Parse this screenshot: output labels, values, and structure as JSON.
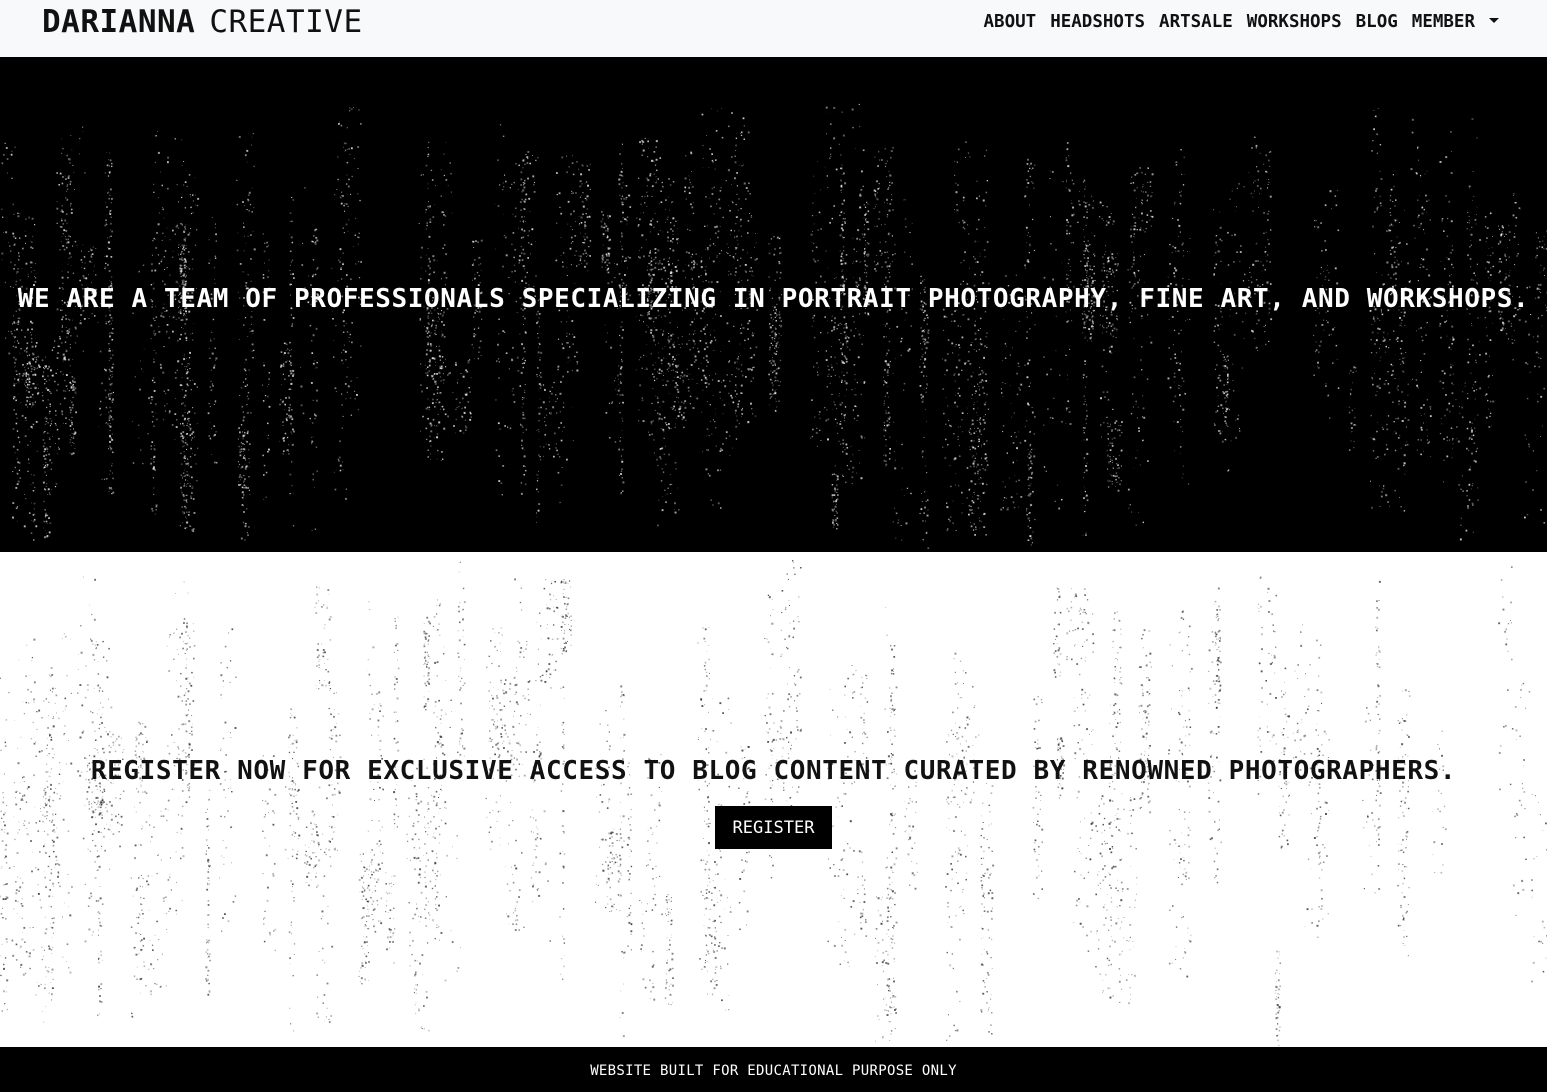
{
  "brand": {
    "name_strong": "DARIANNA",
    "name_light": "CREATIVE"
  },
  "nav": {
    "items": [
      {
        "label": "ABOUT"
      },
      {
        "label": "HEADSHOTS"
      },
      {
        "label": "ARTSALE"
      },
      {
        "label": "WORKSHOPS"
      },
      {
        "label": "BLOG"
      },
      {
        "label": "MEMBER",
        "dropdown": true
      }
    ]
  },
  "hero": {
    "text": "WE ARE A TEAM OF PROFESSIONALS SPECIALIZING IN PORTRAIT PHOTOGRAPHY, FINE ART, AND WORKSHOPS."
  },
  "register": {
    "text": "REGISTER NOW FOR EXCLUSIVE ACCESS TO BLOG CONTENT CURATED BY RENOWNED PHOTOGRAPHERS.",
    "button_label": "REGISTER"
  },
  "footer": {
    "text": "WEBSITE BUILT FOR EDUCATIONAL PURPOSE ONLY"
  },
  "colors": {
    "navbar_bg": "#f8f9fa",
    "hero_bg": "#000000",
    "register_bg": "#ffffff",
    "button_bg": "#000000",
    "footer_bg": "#000000"
  }
}
